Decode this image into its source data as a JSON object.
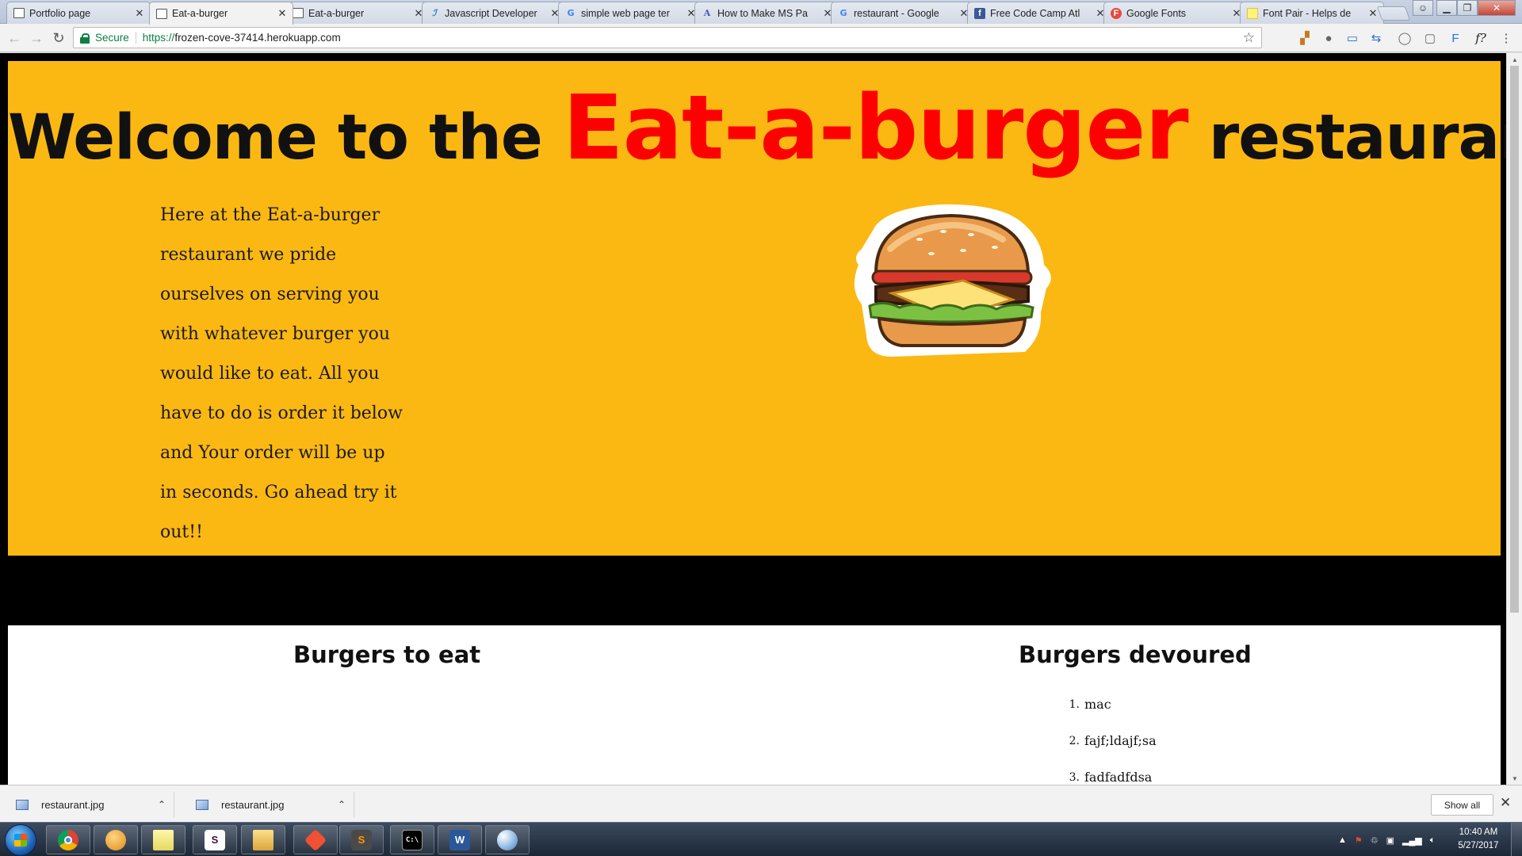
{
  "browser": {
    "tabs": [
      {
        "label": "Portfolio page",
        "icon": "page-icon",
        "active": false
      },
      {
        "label": "Eat-a-burger",
        "icon": "page-icon",
        "active": true
      },
      {
        "label": "Eat-a-burger",
        "icon": "page-icon",
        "active": false
      },
      {
        "label": "Javascript Developer",
        "icon": "javascript-icon",
        "active": false
      },
      {
        "label": "simple web page ter",
        "icon": "google-icon",
        "active": false
      },
      {
        "label": "How to Make MS Pa",
        "icon": "letter-a-icon",
        "active": false
      },
      {
        "label": "restaurant - Google",
        "icon": "google-icon",
        "active": false
      },
      {
        "label": "Free Code Camp Atl",
        "icon": "facebook-icon",
        "active": false
      },
      {
        "label": "Google Fonts",
        "icon": "google-fonts-icon",
        "active": false
      },
      {
        "label": "Font Pair - Helps de",
        "icon": "fontpair-icon",
        "active": false
      }
    ],
    "address": {
      "secure_label": "Secure",
      "url_scheme": "https://",
      "url_host": "frozen-cove-37414.herokuapp.com"
    },
    "close_glyph": "✕"
  },
  "page": {
    "hero": {
      "title_before": "Welcome to the ",
      "title_brand": "Eat-a-burger",
      "title_after": " restaurant",
      "intro": "Here at the Eat-a-burger restaurant we pride ourselves on serving you with whatever burger you would like to eat. All you have to do is order it below and Your order will be up in seconds. Go ahead try it out!!",
      "colors": {
        "background": "#fbb812",
        "brand": "#ff0000",
        "text": "#111111"
      }
    },
    "orders": {
      "to_eat_title": "Burgers to eat",
      "devoured_title": "Burgers devoured",
      "devoured_items": [
        {
          "num": "1.",
          "name": "mac"
        },
        {
          "num": "2.",
          "name": "fajf;ldajf;sa"
        },
        {
          "num": "3.",
          "name": "fadfadfdsa"
        }
      ]
    }
  },
  "downloads": {
    "items": [
      {
        "name": "restaurant.jpg"
      },
      {
        "name": "restaurant.jpg"
      }
    ],
    "show_all_label": "Show all"
  },
  "taskbar": {
    "apps": [
      "chrome-icon",
      "media-icon",
      "sticky-notes-icon",
      "slack-icon",
      "explorer-folder-icon",
      "git-icon",
      "sublime-text-icon",
      "terminal-icon",
      "word-icon",
      "paint-icon"
    ],
    "clock_time": "10:40 AM",
    "clock_date": "5/27/2017"
  }
}
